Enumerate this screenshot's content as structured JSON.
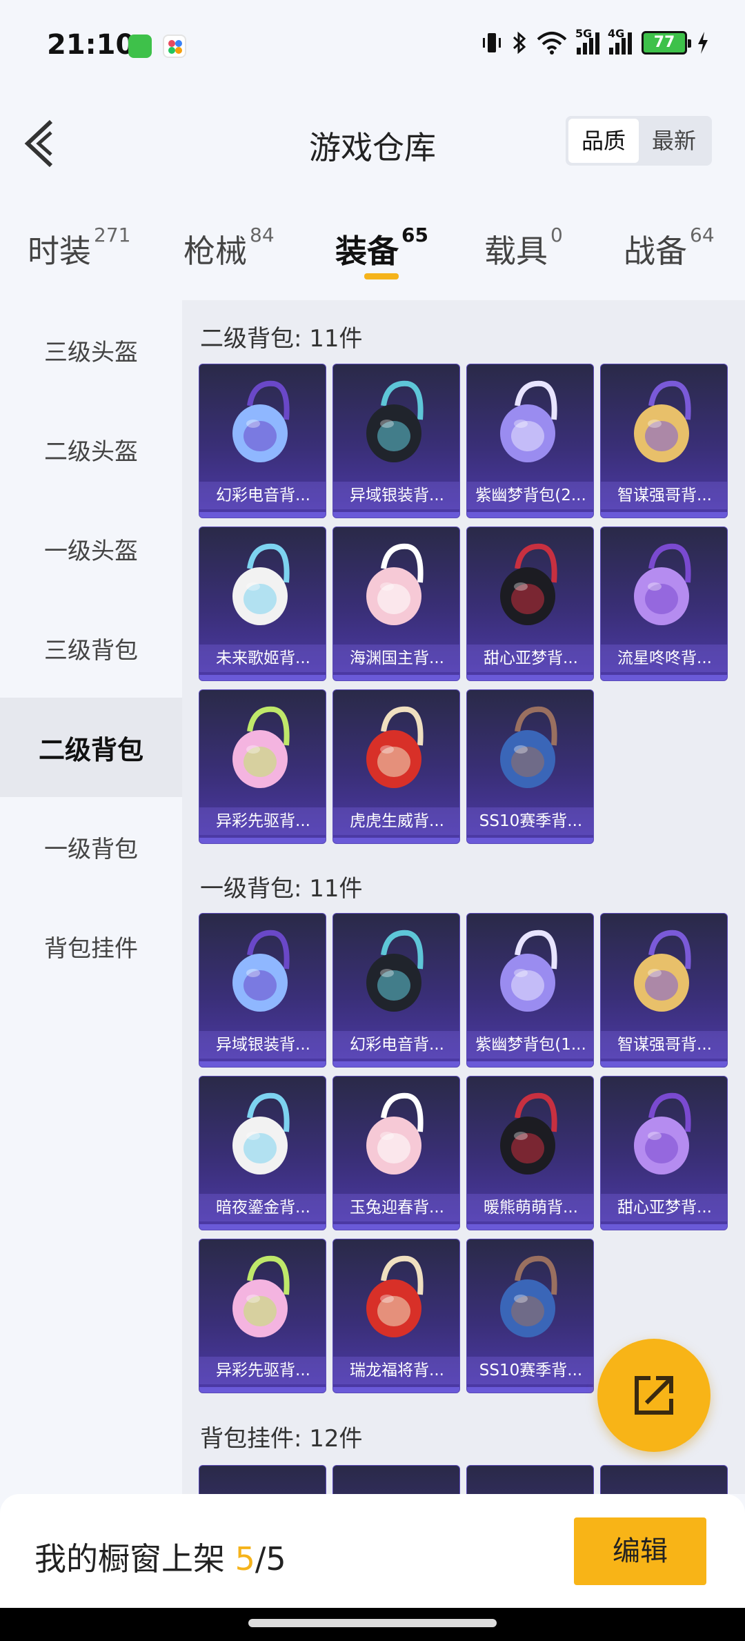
{
  "status_bar": {
    "time": "21:10",
    "network_5g": "5G",
    "network_4g": "4G",
    "battery": "77"
  },
  "header": {
    "title": "游戏仓库",
    "sort_options": [
      "品质",
      "最新"
    ],
    "active_sort": "品质"
  },
  "tabs": [
    {
      "label": "时装",
      "count": "271"
    },
    {
      "label": "枪械",
      "count": "84"
    },
    {
      "label": "装备",
      "count": "65"
    },
    {
      "label": "载具",
      "count": "0"
    },
    {
      "label": "战备",
      "count": "64"
    }
  ],
  "active_tab": "装备",
  "sidebar": {
    "items": [
      "三级头盔",
      "二级头盔",
      "一级头盔",
      "三级背包",
      "二级背包",
      "一级背包",
      "背包挂件"
    ],
    "active": "二级背包"
  },
  "sections": [
    {
      "title": "二级背包: 11件",
      "items": [
        "幻彩电音背...",
        "异域银装背...",
        "紫幽梦背包(2...",
        "智谋强哥背...",
        "未来歌姬背...",
        "海渊国主背...",
        "甜心亚梦背...",
        "流星咚咚背...",
        "异彩先驱背...",
        "虎虎生威背...",
        "SS10赛季背..."
      ]
    },
    {
      "title": "一级背包: 11件",
      "items": [
        "异域银装背...",
        "幻彩电音背...",
        "紫幽梦背包(1...",
        "智谋强哥背...",
        "暗夜鎏金背...",
        "玉兔迎春背...",
        "暖熊萌萌背...",
        "甜心亚梦背...",
        "异彩先驱背...",
        "瑞龙福将背...",
        "SS10赛季背..."
      ]
    },
    {
      "title": "背包挂件: 12件",
      "items": []
    }
  ],
  "bottom_bar": {
    "shelf_label": "我的橱窗上架",
    "shelf_count": "5",
    "shelf_total": "/5",
    "edit_label": "编辑"
  },
  "colors": {
    "accent": "#f8b417",
    "card_bg": "#3a2f78",
    "page_bg": "#f4f6fb"
  },
  "icons": [
    "back-arrow-icon",
    "share-export-icon",
    "bluetooth-icon",
    "wifi-icon",
    "vibrate-icon",
    "charging-icon"
  ]
}
